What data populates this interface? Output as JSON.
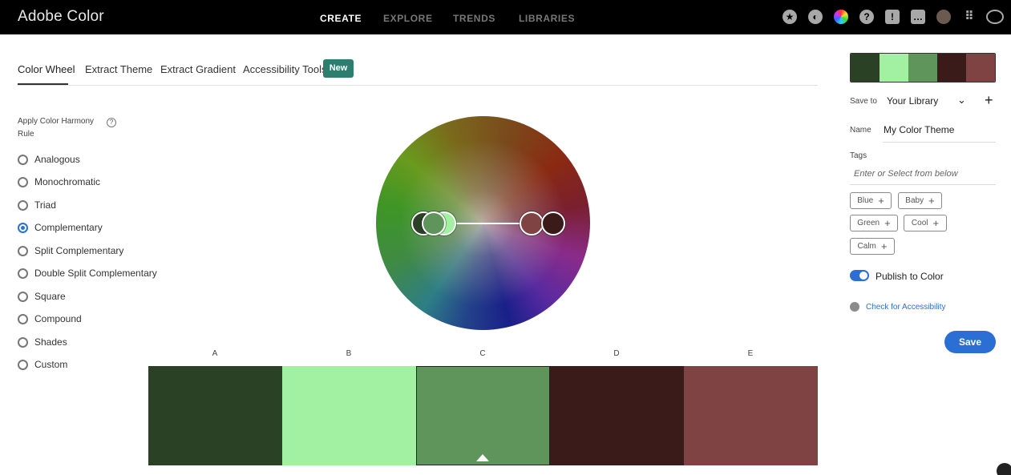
{
  "app": {
    "title": "Adobe Color"
  },
  "nav": [
    {
      "label": "CREATE",
      "active": true
    },
    {
      "label": "EXPLORE",
      "active": false
    },
    {
      "label": "TRENDS",
      "active": false
    },
    {
      "label": "LIBRARIES",
      "active": false
    }
  ],
  "top_icons": [
    "star-icon",
    "moon-icon",
    "color-wheel-icon",
    "help-icon",
    "alert-icon",
    "chat-icon",
    "avatar",
    "apps-grid-icon",
    "creative-cloud-icon"
  ],
  "tabs": [
    {
      "label": "Color Wheel",
      "active": true
    },
    {
      "label": "Extract Theme",
      "active": false
    },
    {
      "label": "Extract Gradient",
      "active": false
    },
    {
      "label": "Accessibility Tools",
      "active": false
    }
  ],
  "new_badge": "New",
  "harmony": {
    "title": "Apply Color Harmony Rule",
    "help": "?",
    "selected": "Complementary",
    "rules": [
      "Analogous",
      "Monochromatic",
      "Triad",
      "Complementary",
      "Split Complementary",
      "Double Split Complementary",
      "Square",
      "Compound",
      "Shades",
      "Custom"
    ]
  },
  "colors": {
    "accent": "#2c6fd4",
    "badge": "#2d7e6f"
  },
  "swatches": [
    {
      "label": "A",
      "hex": "#2a4125"
    },
    {
      "label": "B",
      "hex": "#a2f0a2"
    },
    {
      "label": "C",
      "hex": "#5f955b"
    },
    {
      "label": "D",
      "hex": "#3b1a1a"
    },
    {
      "label": "E",
      "hex": "#804343"
    }
  ],
  "selected_swatch": "C",
  "panel": {
    "save_to_label": "Save to",
    "library": "Your Library",
    "name_label": "Name",
    "name_value": "My Color Theme",
    "tags_label": "Tags",
    "tags_placeholder": "Enter or Select from below",
    "tags": [
      "Blue",
      "Baby",
      "Green",
      "Cool",
      "Calm"
    ],
    "publish_label": "Publish to Color",
    "publish_on": true,
    "accessibility_link": "Check for Accessibility",
    "save_button": "Save"
  }
}
